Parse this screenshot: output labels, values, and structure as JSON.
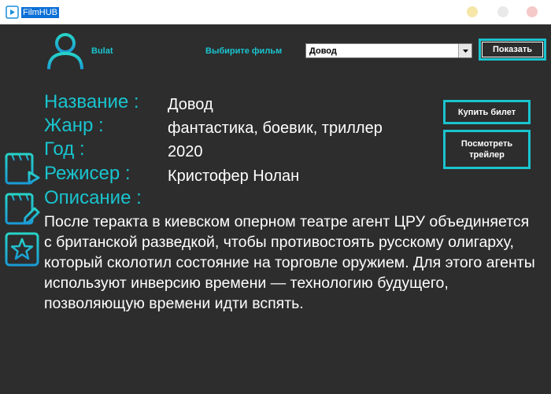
{
  "window": {
    "title": "FilmHUB"
  },
  "header": {
    "username": "Bulat",
    "select_label": "Выбирите фильм",
    "selected_film": "Довод",
    "show_button": "Показать"
  },
  "actions": {
    "buy_ticket": "Купить билет",
    "watch_trailer": "Посмотреть трейлер"
  },
  "film": {
    "title_label": "Название :",
    "title_value": "Довод",
    "genre_label": "Жанр :",
    "genre_value": "фантастика, боевик, триллер",
    "year_label": "Год :",
    "year_value": "2020",
    "director_label": "Режисер :",
    "director_value": "Кристофер Нолан",
    "description_label": "Описание :",
    "description": "После теракта в киевском оперном театре агент ЦРУ объединяется с британской разведкой, чтобы противостоять русскому олигарху, который сколотил состояние на торговле оружием. Для этого агенты используют инверсию времени — технологию будущего, позволяющую времени идти вспять."
  },
  "sidebar": {
    "icons": [
      "video-icon",
      "edit-icon",
      "star-icon"
    ]
  },
  "colors": {
    "accent": "#19c4cf",
    "background": "#2d2d2d"
  }
}
